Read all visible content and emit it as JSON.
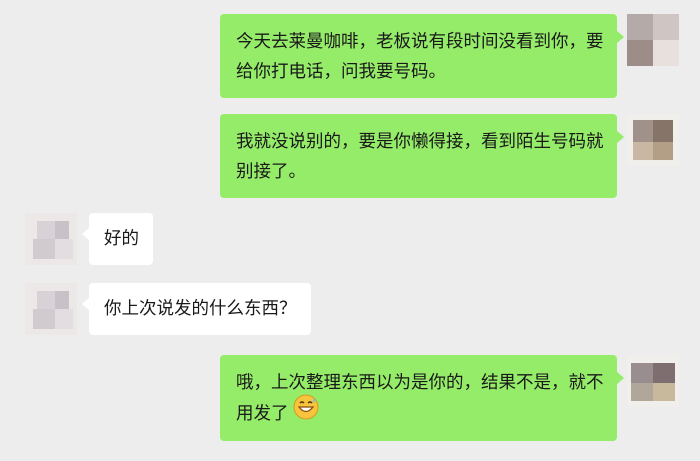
{
  "messages": [
    {
      "side": "right",
      "text": "今天去莱曼咖啡，老板说有段时间没看到你，要给你打电话，问我要号码。"
    },
    {
      "side": "right",
      "text": "我就没说别的，要是你懒得接，看到陌生号码就别接了。"
    },
    {
      "side": "left",
      "text": "好的"
    },
    {
      "side": "left",
      "text": "你上次说发的什么东西？"
    },
    {
      "side": "right",
      "text": "哦，上次整理东西以为是你的，结果不是，就不用发了",
      "emoji": "grinning-sweat-emoji"
    }
  ],
  "colors": {
    "background": "#ededed",
    "outgoing_bubble": "#95ec69",
    "incoming_bubble": "#ffffff"
  }
}
